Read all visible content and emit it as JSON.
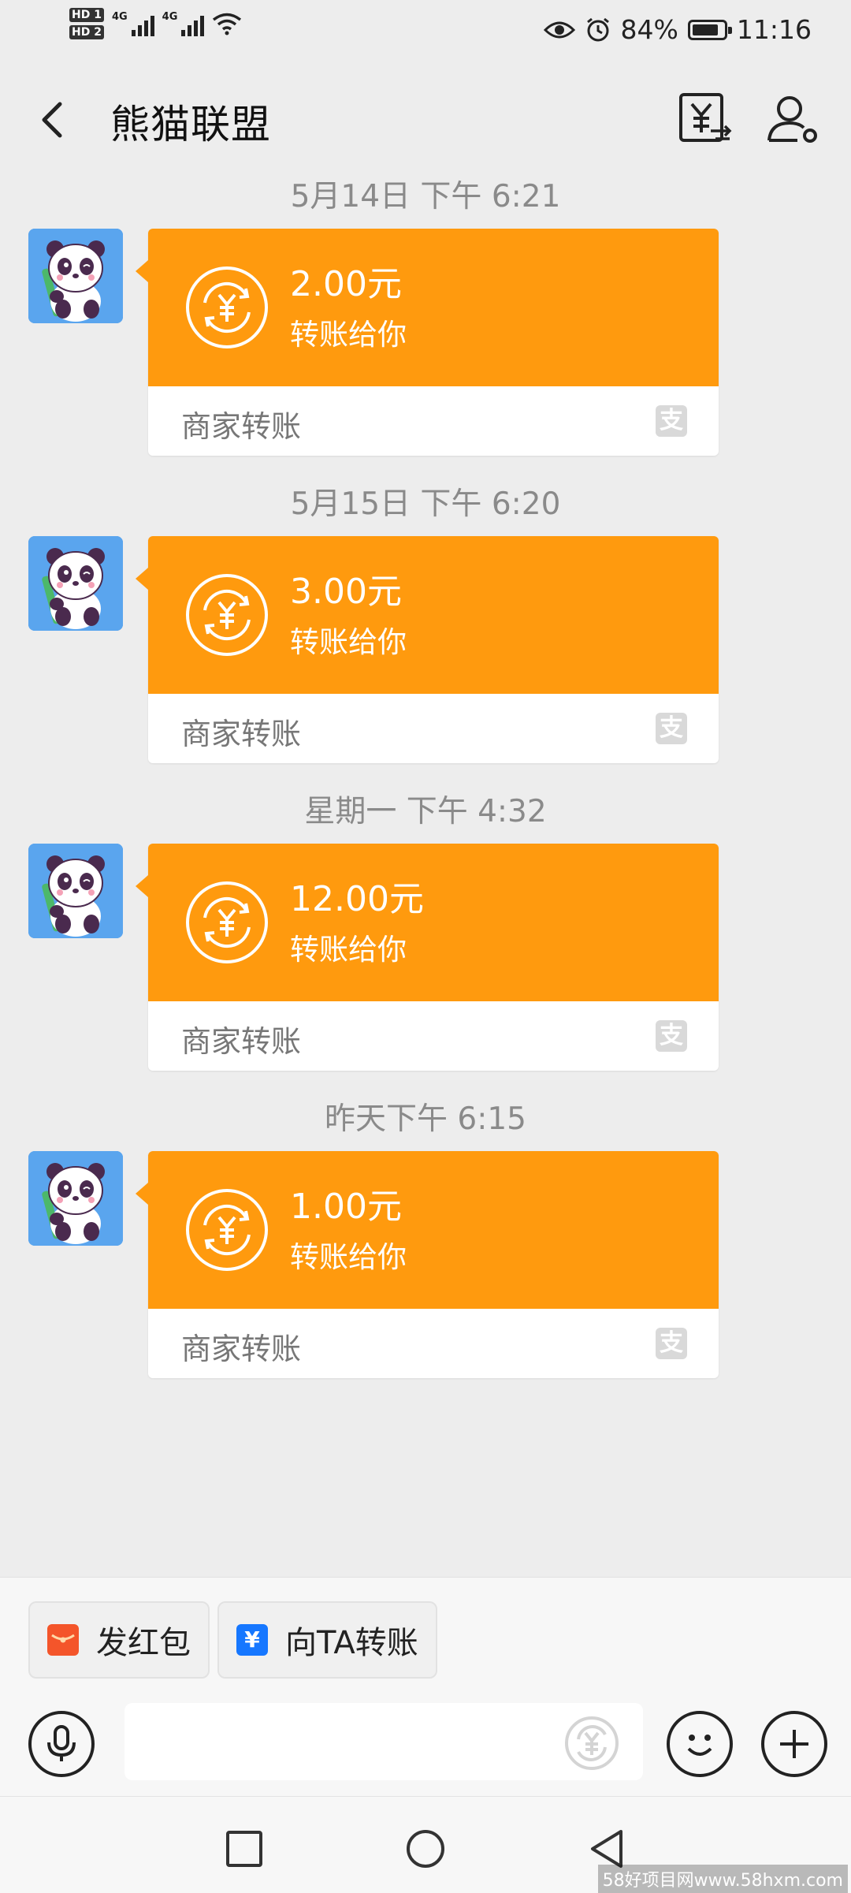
{
  "status_bar": {
    "network1": "4G",
    "network2": "4G",
    "hd1": "HD 1",
    "hd2": "HD 2",
    "battery_pct": "84%",
    "battery_level": 0.84,
    "time": "11:16"
  },
  "header": {
    "title": "熊猫联盟"
  },
  "colors": {
    "accent_orange": "#ff9a0e",
    "background": "#ededed",
    "avatar_bg": "#5aa5ee"
  },
  "messages": [
    {
      "timestamp": "5月14日 下午 6:21",
      "amount": "2.00元",
      "subtitle": "转账给你",
      "footer": "商家转账",
      "badge": "支"
    },
    {
      "timestamp": "5月15日 下午 6:20",
      "amount": "3.00元",
      "subtitle": "转账给你",
      "footer": "商家转账",
      "badge": "支"
    },
    {
      "timestamp": "星期一 下午 4:32",
      "amount": "12.00元",
      "subtitle": "转账给你",
      "footer": "商家转账",
      "badge": "支"
    },
    {
      "timestamp": "昨天下午 6:15",
      "amount": "1.00元",
      "subtitle": "转账给你",
      "footer": "商家转账",
      "badge": "支"
    }
  ],
  "quick_actions": {
    "red_packet": "发红包",
    "red_packet_icon_glyph": "",
    "transfer": "向TA转账",
    "transfer_icon_glyph": "¥"
  },
  "watermark": "58好项目网www.58hxm.com"
}
